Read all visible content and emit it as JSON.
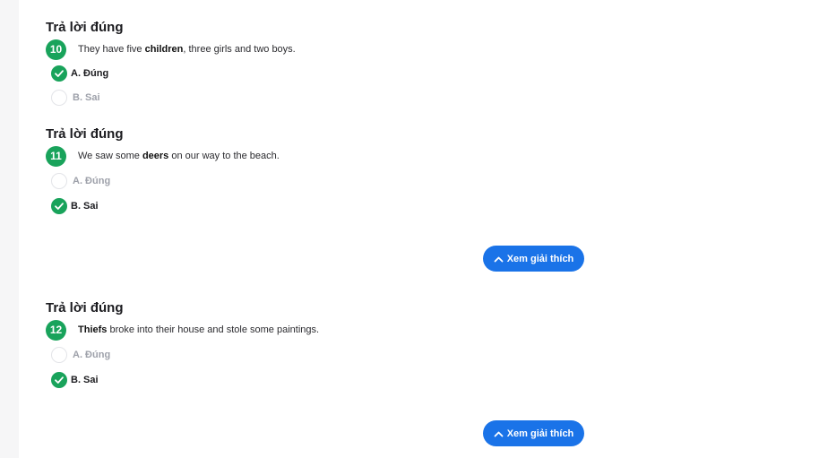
{
  "status_label": "Trả lời đúng",
  "explain_label": "Xem giải thích",
  "questions": [
    {
      "number": "10",
      "text_before": "They have five ",
      "keyword": "children",
      "text_after": ", three girls and two boys.",
      "options": [
        {
          "label": "A. Đúng",
          "selected": true
        },
        {
          "label": "B. Sai",
          "selected": false
        }
      ]
    },
    {
      "number": "11",
      "text_before": "We saw some ",
      "keyword": "deers",
      "text_after": " on our way to the beach.",
      "options": [
        {
          "label": "A. Đúng",
          "selected": false
        },
        {
          "label": "B. Sai",
          "selected": true
        }
      ]
    },
    {
      "number": "12",
      "text_before": "",
      "keyword": "Thiefs",
      "text_after": " broke into their house and stole some paintings.",
      "options": [
        {
          "label": "A. Đúng",
          "selected": false
        },
        {
          "label": "B. Sai",
          "selected": true
        }
      ]
    }
  ],
  "colors": {
    "correct_green": "#19a35b",
    "button_blue": "#1a73e8",
    "muted_text": "#9ea1aa"
  },
  "icons": {
    "check": "check-icon",
    "chevron": "chevron-up-icon"
  }
}
